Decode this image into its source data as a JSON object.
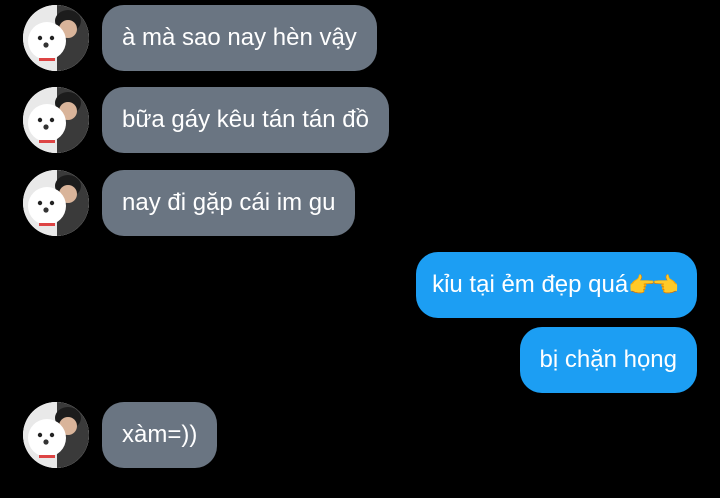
{
  "colors": {
    "incoming_bubble": "#6a7582",
    "outgoing_bubble": "#1c9ef3",
    "background": "#000000"
  },
  "messages": [
    {
      "side": "incoming",
      "text": "à mà sao nay hèn vậy"
    },
    {
      "side": "incoming",
      "text": "bữa gáy kêu tán tán đồ"
    },
    {
      "side": "incoming",
      "text": "nay đi gặp cái im gu"
    },
    {
      "side": "outgoing",
      "text": "kỉu tại ẻm đẹp quá",
      "emoji": "👉👈"
    },
    {
      "side": "outgoing",
      "text": "bị chặn họng"
    },
    {
      "side": "incoming",
      "text": "xàm=))"
    }
  ]
}
